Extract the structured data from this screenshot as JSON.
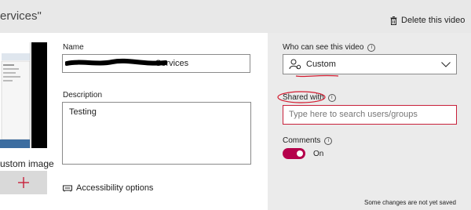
{
  "header": {
    "title": "ervices\"",
    "delete_label": "Delete this video"
  },
  "left": {
    "custom_image_label": "ustom image"
  },
  "details": {
    "name_label": "Name",
    "name_value": "Services",
    "description_label": "Description",
    "description_value": "Testing",
    "accessibility_label": "Accessibility options"
  },
  "permissions": {
    "who_label": "Who can see this video",
    "who_value": "Custom",
    "shared_label": "Shared with",
    "search_placeholder": "Type here to search users/groups",
    "comments_label": "Comments",
    "comments_state": "On"
  },
  "status": {
    "unsaved_note": "Some changes are not yet saved"
  },
  "colors": {
    "accent": "#b5004b",
    "annotation": "#d21b2f",
    "panel": "#ebebeb"
  },
  "icons": [
    "trash-icon",
    "plus-icon",
    "accessibility-icon",
    "person-icon",
    "chevron-down-icon",
    "info-icon"
  ]
}
